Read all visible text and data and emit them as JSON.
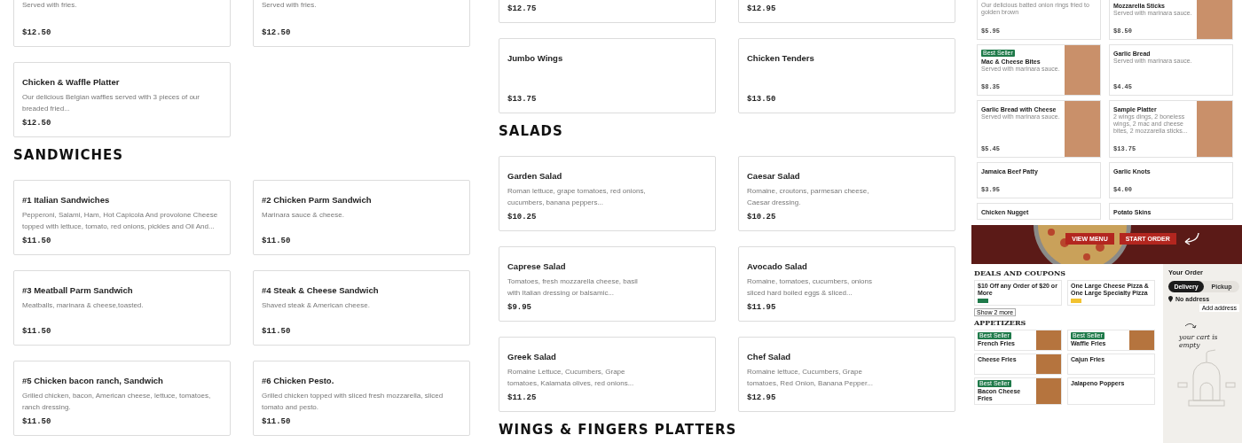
{
  "left_menu": {
    "blocks": [
      {
        "kind": "cards",
        "cards": [
          {
            "description": "Served with fries.",
            "price": "$12.50"
          },
          {
            "description": "Served with fries.",
            "price": "$12.50"
          },
          {
            "title": "Chicken & Waffle Platter",
            "description": "Our delicious Belgian waffles served with 3 pieces of our breaded fried...",
            "price": "$12.50"
          }
        ]
      },
      {
        "kind": "heading",
        "text": "SANDWICHES"
      },
      {
        "kind": "cards",
        "cards": [
          {
            "title": "#1 Italian Sandwiches",
            "description": "Pepperoni, Salami, Ham, Hot Capicola And provolone Cheese topped with lettuce, tomato, red onions, pickles and Oil And...",
            "price": "$11.50"
          },
          {
            "title": "#2 Chicken Parm Sandwich",
            "description": "Marinara sauce & cheese.",
            "price": "$11.50"
          },
          {
            "title": "#3 Meatball Parm Sandwich",
            "description": "Meatballs, marinara & cheese,toasted.",
            "price": "$11.50"
          },
          {
            "title": "#4 Steak & Cheese Sandwich",
            "description": "Shaved steak & American cheese.",
            "price": "$11.50"
          },
          {
            "title": "#5 Chicken bacon ranch, Sandwich",
            "description": "Grilled chicken, bacon, American cheese, lettuce, tomatoes, ranch dressing.",
            "price": "$11.50"
          },
          {
            "title": "#6 Chicken Pesto.",
            "description": "Grilled chicken topped with sliced fresh mozzarella, sliced tomato and pesto.",
            "price": "$11.50"
          }
        ]
      }
    ]
  },
  "middle_menu": {
    "blocks": [
      {
        "kind": "cards",
        "cards": [
          {
            "price": "$12.75"
          },
          {
            "price": "$12.95"
          },
          {
            "title": "Jumbo Wings",
            "price": "$13.75"
          },
          {
            "title": "Chicken Tenders",
            "price": "$13.50"
          }
        ]
      },
      {
        "kind": "heading",
        "text": "SALADS"
      },
      {
        "kind": "cards",
        "cards": [
          {
            "title": "Garden Salad",
            "description": "Roman lettuce, grape tomatoes, red onions, cucumbers, banana peppers...",
            "price": "$10.25"
          },
          {
            "title": "Caesar Salad",
            "description": "Romaine, croutons, parmesan cheese, Caesar dressing.",
            "price": "$10.25"
          },
          {
            "title": "Caprese Salad",
            "description": "Tomatoes, fresh mozzarella cheese, basil with Italian dressing or balsamic...",
            "price": "$9.95"
          },
          {
            "title": "Avocado Salad",
            "description": "Romaine, tomatoes, cucumbers, onions sliced hard boiled eggs & sliced...",
            "price": "$11.95"
          },
          {
            "title": "Greek Salad",
            "description": "Romaine Lettuce, Cucumbers, Grape tomatoes, Kalamata olives, red onions...",
            "price": "$11.25"
          },
          {
            "title": "Chef Salad",
            "description": "Romaine lettuce, Cucumbers, Grape tomatoes, Red Onion, Banana Pepper...",
            "price": "$12.95"
          }
        ]
      },
      {
        "kind": "heading",
        "text": "WINGS & FINGERS PLATTERS"
      }
    ]
  },
  "thumbnail_menu": {
    "cards": [
      {
        "description": "Our delicious batted onion rings fried to golden brown",
        "price": "$5.95",
        "photo": false
      },
      {
        "title": "Mozzarella Sticks",
        "description": "Served with marinara sauce.",
        "price": "$8.50",
        "photo": true
      },
      {
        "badge": "Best Seller",
        "title": "Mac & Cheese Bites",
        "description": "Served with marinara sauce.",
        "price": "$8.35",
        "photo": true
      },
      {
        "title": "Garlic Bread",
        "description": "Served with marinara sauce.",
        "price": "$4.45",
        "photo": false
      },
      {
        "title": "Garlic Bread with Cheese",
        "description": "Served with marinara sauce.",
        "price": "$5.45",
        "photo": true
      },
      {
        "title": "Sample Platter",
        "description": "2 wings dings, 2 boneless wings, 2 mac and cheese bites, 2 mozzarella sticks...",
        "price": "$13.75",
        "photo": true
      },
      {
        "title": "Jamaica Beef Patty",
        "price": "$3.95",
        "photo": false
      },
      {
        "title": "Garlic Knots",
        "price": "$4.00",
        "photo": false
      },
      {
        "title": "Chicken Nugget",
        "photo": false
      },
      {
        "title": "Potato Skins",
        "photo": false
      }
    ]
  },
  "restaurant_page": {
    "hero_buttons": [
      "VIEW MENU",
      "START ORDER"
    ],
    "sections": [
      {
        "heading": "DEALS AND COUPONS",
        "cards": [
          {
            "title": "$10 Off any Order of $20 or More",
            "color": "#1f7a4a",
            "photo": false
          },
          {
            "title": "One Large Cheese Pizza & One Large Specialty Pizza",
            "color": "#f2c230",
            "photo": false
          }
        ],
        "more_button": "Show 2 more"
      },
      {
        "heading": "APPETIZERS",
        "cards": [
          {
            "badge": "Best Seller",
            "title": "French Fries",
            "photo": true
          },
          {
            "badge": "Best Seller",
            "title": "Waffle Fries",
            "photo": true
          },
          {
            "title": "Cheese Fries",
            "photo": true
          },
          {
            "title": "Cajun Fries",
            "photo": false
          },
          {
            "badge": "Best Seller",
            "title": "Bacon Cheese Fries",
            "photo": true
          },
          {
            "title": "Jalapeno Poppers",
            "photo": false
          }
        ]
      }
    ],
    "order": {
      "title": "Your Order",
      "modes": [
        {
          "label": "Delivery",
          "selected": true
        },
        {
          "label": "Pickup",
          "selected": false
        }
      ],
      "address": "No address",
      "address_button": "Add address",
      "empty_text": "your cart is empty"
    }
  }
}
